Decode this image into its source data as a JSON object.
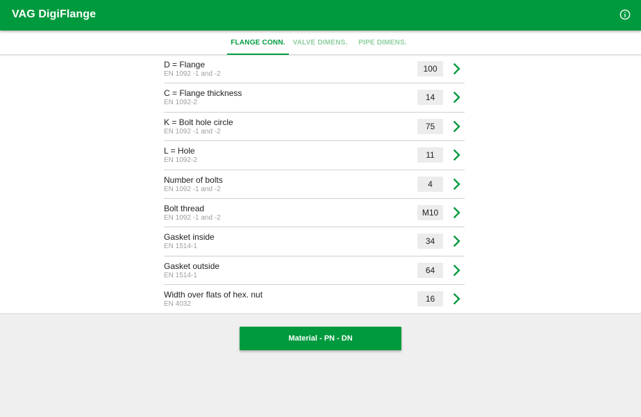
{
  "app": {
    "title": "VAG DigiFlange"
  },
  "tabs": [
    {
      "label": "FLANGE CONN.",
      "active": true
    },
    {
      "label": "VALVE DIMENS.",
      "active": false
    },
    {
      "label": "PIPE DIMENS.",
      "active": false
    }
  ],
  "rows": [
    {
      "title": "D = Flange",
      "subtitle": "EN 1092 -1 and -2",
      "value": "100"
    },
    {
      "title": "C = Flange thickness",
      "subtitle": "EN 1092-2",
      "value": "14"
    },
    {
      "title": "K = Bolt hole circle",
      "subtitle": "EN 1092 -1 and -2",
      "value": "75"
    },
    {
      "title": "L = Hole",
      "subtitle": "EN 1092-2",
      "value": "11"
    },
    {
      "title": "Number of bolts",
      "subtitle": "EN 1092 -1 and -2",
      "value": "4"
    },
    {
      "title": "Bolt thread",
      "subtitle": "EN 1092 -1 and -2",
      "value": "M10"
    },
    {
      "title": "Gasket inside",
      "subtitle": "EN 1514-1",
      "value": "34"
    },
    {
      "title": "Gasket outside",
      "subtitle": "EN 1514-1",
      "value": "64"
    },
    {
      "title": "Width over flats of hex. nut",
      "subtitle": "EN 4032",
      "value": "16"
    }
  ],
  "action_button": {
    "label": "Material - PN - DN"
  },
  "colors": {
    "primary": "#009a3e",
    "tab_inactive": "#8fcf9f",
    "background": "#efefef"
  },
  "icons": {
    "info": "info-icon",
    "row_action": "chevron-right-icon"
  }
}
